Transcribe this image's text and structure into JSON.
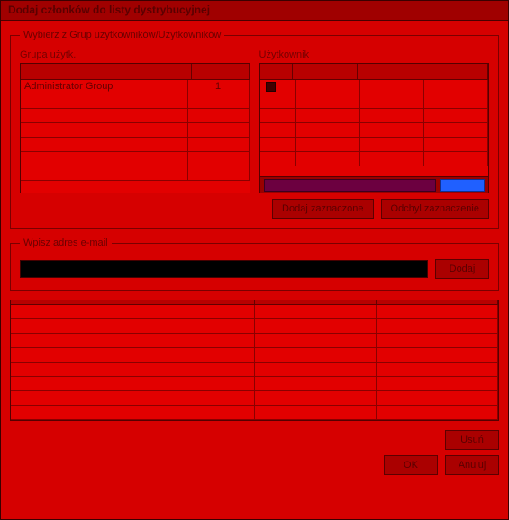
{
  "window": {
    "title": "Dodaj członków do listy dystrybucyjnej"
  },
  "group_select": {
    "legend": "Wybierz z Grup użytkowników/Użytkowników",
    "groups_label": "Grupa użytk.",
    "users_label": "Użytkownik",
    "group_rows": [
      {
        "name": "Administrator Group",
        "count": "1"
      },
      {
        "name": "",
        "count": ""
      },
      {
        "name": "",
        "count": ""
      },
      {
        "name": "",
        "count": ""
      },
      {
        "name": "",
        "count": ""
      },
      {
        "name": "",
        "count": ""
      },
      {
        "name": "",
        "count": ""
      }
    ],
    "user_rows": [
      {
        "chk": true,
        "a": "",
        "b": "",
        "c": ""
      },
      {
        "chk": false,
        "a": "",
        "b": "",
        "c": ""
      },
      {
        "chk": false,
        "a": "",
        "b": "",
        "c": ""
      },
      {
        "chk": false,
        "a": "",
        "b": "",
        "c": ""
      },
      {
        "chk": false,
        "a": "",
        "b": "",
        "c": ""
      },
      {
        "chk": false,
        "a": "",
        "b": "",
        "c": ""
      }
    ],
    "btn_add_selected": "Dodaj zaznaczone",
    "btn_clear_selected": "Odchyl zaznaczenie"
  },
  "group_email": {
    "legend": "Wpisz adres e-mail",
    "btn_add": "Dodaj"
  },
  "members_grid": {
    "rows_count": 8
  },
  "bottom": {
    "btn_delete": "Usuń",
    "btn_ok": "OK",
    "btn_cancel": "Anuluj"
  }
}
